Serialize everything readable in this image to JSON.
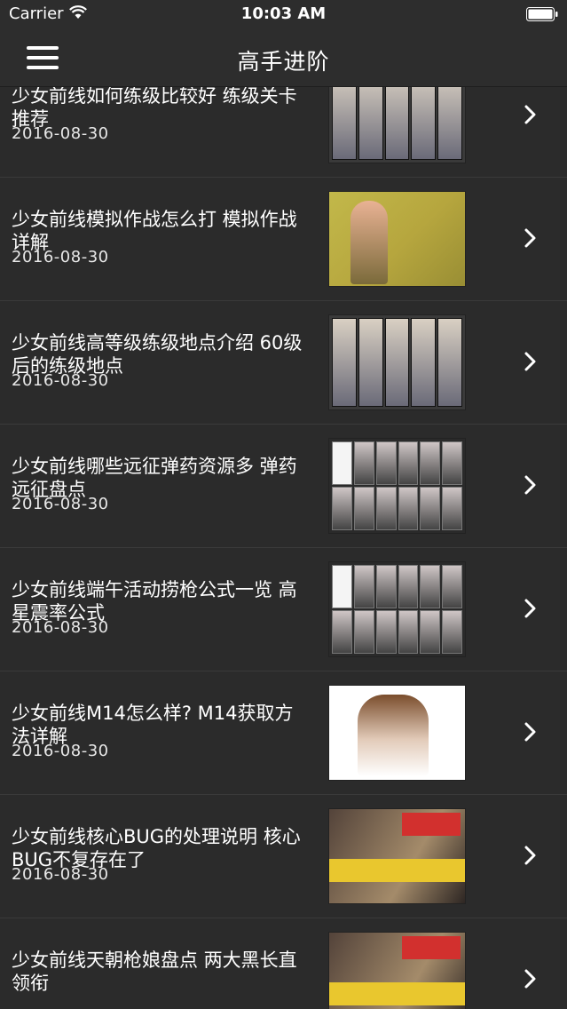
{
  "status_bar": {
    "carrier": "Carrier",
    "time": "10:03 AM"
  },
  "nav": {
    "title": "高手进阶",
    "menu_icon": "hamburger-menu-icon"
  },
  "colors": {
    "background": "#2b2b2b",
    "bar": "#2d2d2d",
    "text": "#ffffff"
  },
  "articles": [
    {
      "title": "少女前线如何练级比较好 练级关卡推荐",
      "date": "2016-08-30",
      "thumb": "cards"
    },
    {
      "title": "少女前线模拟作战怎么打 模拟作战详解",
      "date": "2016-08-30",
      "thumb": "field"
    },
    {
      "title": "少女前线高等级练级地点介绍 60级后的练级地点",
      "date": "2016-08-30",
      "thumb": "cards"
    },
    {
      "title": "少女前线哪些远征弹药资源多 弹药远征盘点",
      "date": "2016-08-30",
      "thumb": "grid"
    },
    {
      "title": "少女前线端午活动捞枪公式一览 高星震率公式",
      "date": "2016-08-30",
      "thumb": "grid"
    },
    {
      "title": "少女前线M14怎么样? M14获取方法详解",
      "date": "2016-08-30",
      "thumb": "white"
    },
    {
      "title": "少女前线核心BUG的处理说明 核心BUG不复存在了",
      "date": "2016-08-30",
      "thumb": "banner"
    },
    {
      "title": "少女前线天朝枪娘盘点 两大黑长直领衔",
      "date": "",
      "thumb": "banner"
    }
  ]
}
